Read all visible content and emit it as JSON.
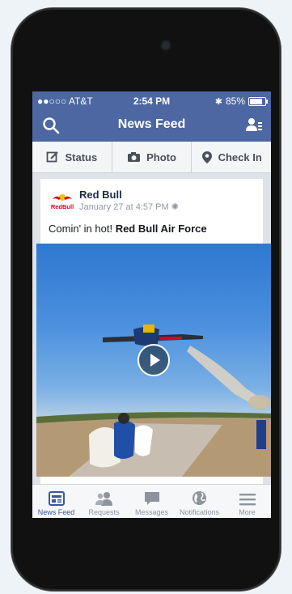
{
  "status_bar": {
    "carrier": "●●○○○ AT&T",
    "time": "2:54 PM",
    "battery": "85%"
  },
  "nav": {
    "title": "News Feed"
  },
  "composer": {
    "status_label": "Status",
    "photo_label": "Photo",
    "checkin_label": "Check In"
  },
  "post": {
    "author": "Red Bull",
    "timestamp": "January 27 at 4:57 PM",
    "message_prefix": "Comin' in hot! ",
    "message_highlight": "Red Bull Air Force",
    "logo_text": "RedBull"
  },
  "tabs": [
    {
      "label": "News Feed",
      "icon": "news-feed-icon",
      "active": true
    },
    {
      "label": "Requests",
      "icon": "requests-icon"
    },
    {
      "label": "Messages",
      "icon": "messages-icon"
    },
    {
      "label": "Notifications",
      "icon": "globe-icon"
    },
    {
      "label": "More",
      "icon": "menu-icon"
    }
  ],
  "colors": {
    "header_blue": "#4c67a1",
    "accent": "#3b5998"
  }
}
